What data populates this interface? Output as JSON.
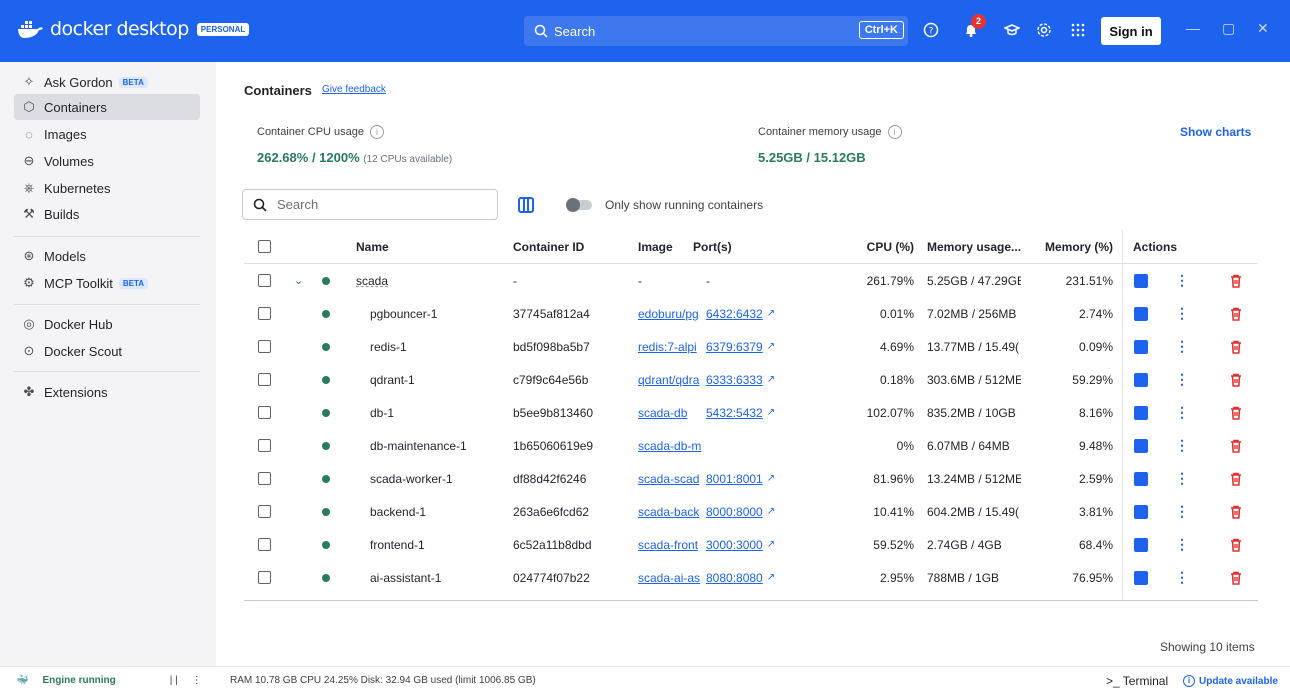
{
  "app": {
    "logo_text": "docker desktop",
    "edition_badge": "PERSONAL",
    "search_placeholder": "Search",
    "search_shortcut": "Ctrl+K",
    "notification_count": "2",
    "sign_in_label": "Sign in",
    "accent_color": "#1d63ed"
  },
  "sidebar": {
    "items": [
      {
        "label": "Ask Gordon",
        "badge": "BETA",
        "icon": "sparkle-icon"
      },
      {
        "label": "Containers",
        "icon": "cube-icon",
        "active": true
      },
      {
        "label": "Images",
        "icon": "layers-icon"
      },
      {
        "label": "Volumes",
        "icon": "drive-icon"
      },
      {
        "label": "Kubernetes",
        "icon": "helm-icon"
      },
      {
        "label": "Builds",
        "icon": "wrench-icon"
      },
      {
        "label": "Models",
        "icon": "model-icon"
      },
      {
        "label": "MCP Toolkit",
        "badge": "BETA",
        "icon": "toolkit-icon"
      },
      {
        "label": "Docker Hub",
        "icon": "hub-icon"
      },
      {
        "label": "Docker Scout",
        "icon": "scout-icon"
      },
      {
        "label": "Extensions",
        "icon": "puzzle-icon"
      }
    ]
  },
  "main": {
    "title": "Containers",
    "feedback_link": "Give feedback",
    "cpu": {
      "label": "Container CPU usage",
      "used": "262.68%",
      "total": " / 1200%",
      "note": "(12 CPUs available)"
    },
    "memory": {
      "label": "Container memory usage",
      "used": "5.25GB",
      "total": " / 15.12GB"
    },
    "show_charts": "Show charts",
    "search_placeholder": "Search",
    "toggle_label": "Only show running containers",
    "columns": [
      "Name",
      "Container ID",
      "Image",
      "Port(s)",
      "CPU (%)",
      "Memory usage...",
      "Memory (%)",
      "Actions"
    ],
    "rows": [
      {
        "name": "scada",
        "id": "-",
        "image": "-",
        "port": "-",
        "cpu": "261.79%",
        "mem_usage": "5.25GB / 47.29GE",
        "mem_pct": "231.51%",
        "group": true
      },
      {
        "name": "pgbouncer-1",
        "id": "37745af812a4",
        "image": "edoburu/pg",
        "port": "6432:6432",
        "cpu": "0.01%",
        "mem_usage": "7.02MB / 256MB",
        "mem_pct": "2.74%"
      },
      {
        "name": "redis-1",
        "id": "bd5f098ba5b7",
        "image": "redis:7-alpi",
        "port": "6379:6379",
        "cpu": "4.69%",
        "mem_usage": "13.77MB / 15.49(",
        "mem_pct": "0.09%"
      },
      {
        "name": "qdrant-1",
        "id": "c79f9c64e56b",
        "image": "qdrant/qdra",
        "port": "6333:6333",
        "cpu": "0.18%",
        "mem_usage": "303.6MB / 512ME",
        "mem_pct": "59.29%"
      },
      {
        "name": "db-1",
        "id": "b5ee9b813460",
        "image": "scada-db",
        "port": "5432:5432",
        "cpu": "102.07%",
        "mem_usage": "835.2MB / 10GB",
        "mem_pct": "8.16%"
      },
      {
        "name": "db-maintenance-1",
        "id": "1b65060619e9",
        "image": "scada-db-m",
        "port": "",
        "cpu": "0%",
        "mem_usage": "6.07MB / 64MB",
        "mem_pct": "9.48%"
      },
      {
        "name": "scada-worker-1",
        "id": "df88d42f6246",
        "image": "scada-scad",
        "port": "8001:8001",
        "cpu": "81.96%",
        "mem_usage": "13.24MB / 512ME",
        "mem_pct": "2.59%"
      },
      {
        "name": "backend-1",
        "id": "263a6e6fcd62",
        "image": "scada-back",
        "port": "8000:8000",
        "cpu": "10.41%",
        "mem_usage": "604.2MB / 15.49(",
        "mem_pct": "3.81%"
      },
      {
        "name": "frontend-1",
        "id": "6c52a11b8dbd",
        "image": "scada-front",
        "port": "3000:3000",
        "cpu": "59.52%",
        "mem_usage": "2.74GB / 4GB",
        "mem_pct": "68.4%"
      },
      {
        "name": "ai-assistant-1",
        "id": "024774f07b22",
        "image": "scada-ai-as",
        "port": "8080:8080",
        "cpu": "2.95%",
        "mem_usage": "788MB / 1GB",
        "mem_pct": "76.95%"
      }
    ],
    "showing": "Showing 10 items"
  },
  "statusbar": {
    "engine": "Engine running",
    "stats": "RAM 10.78 GB  CPU 24.25%  Disk: 32.94 GB used (limit 1006.85 GB)",
    "terminal": ">_ Terminal",
    "update": "Update available"
  }
}
